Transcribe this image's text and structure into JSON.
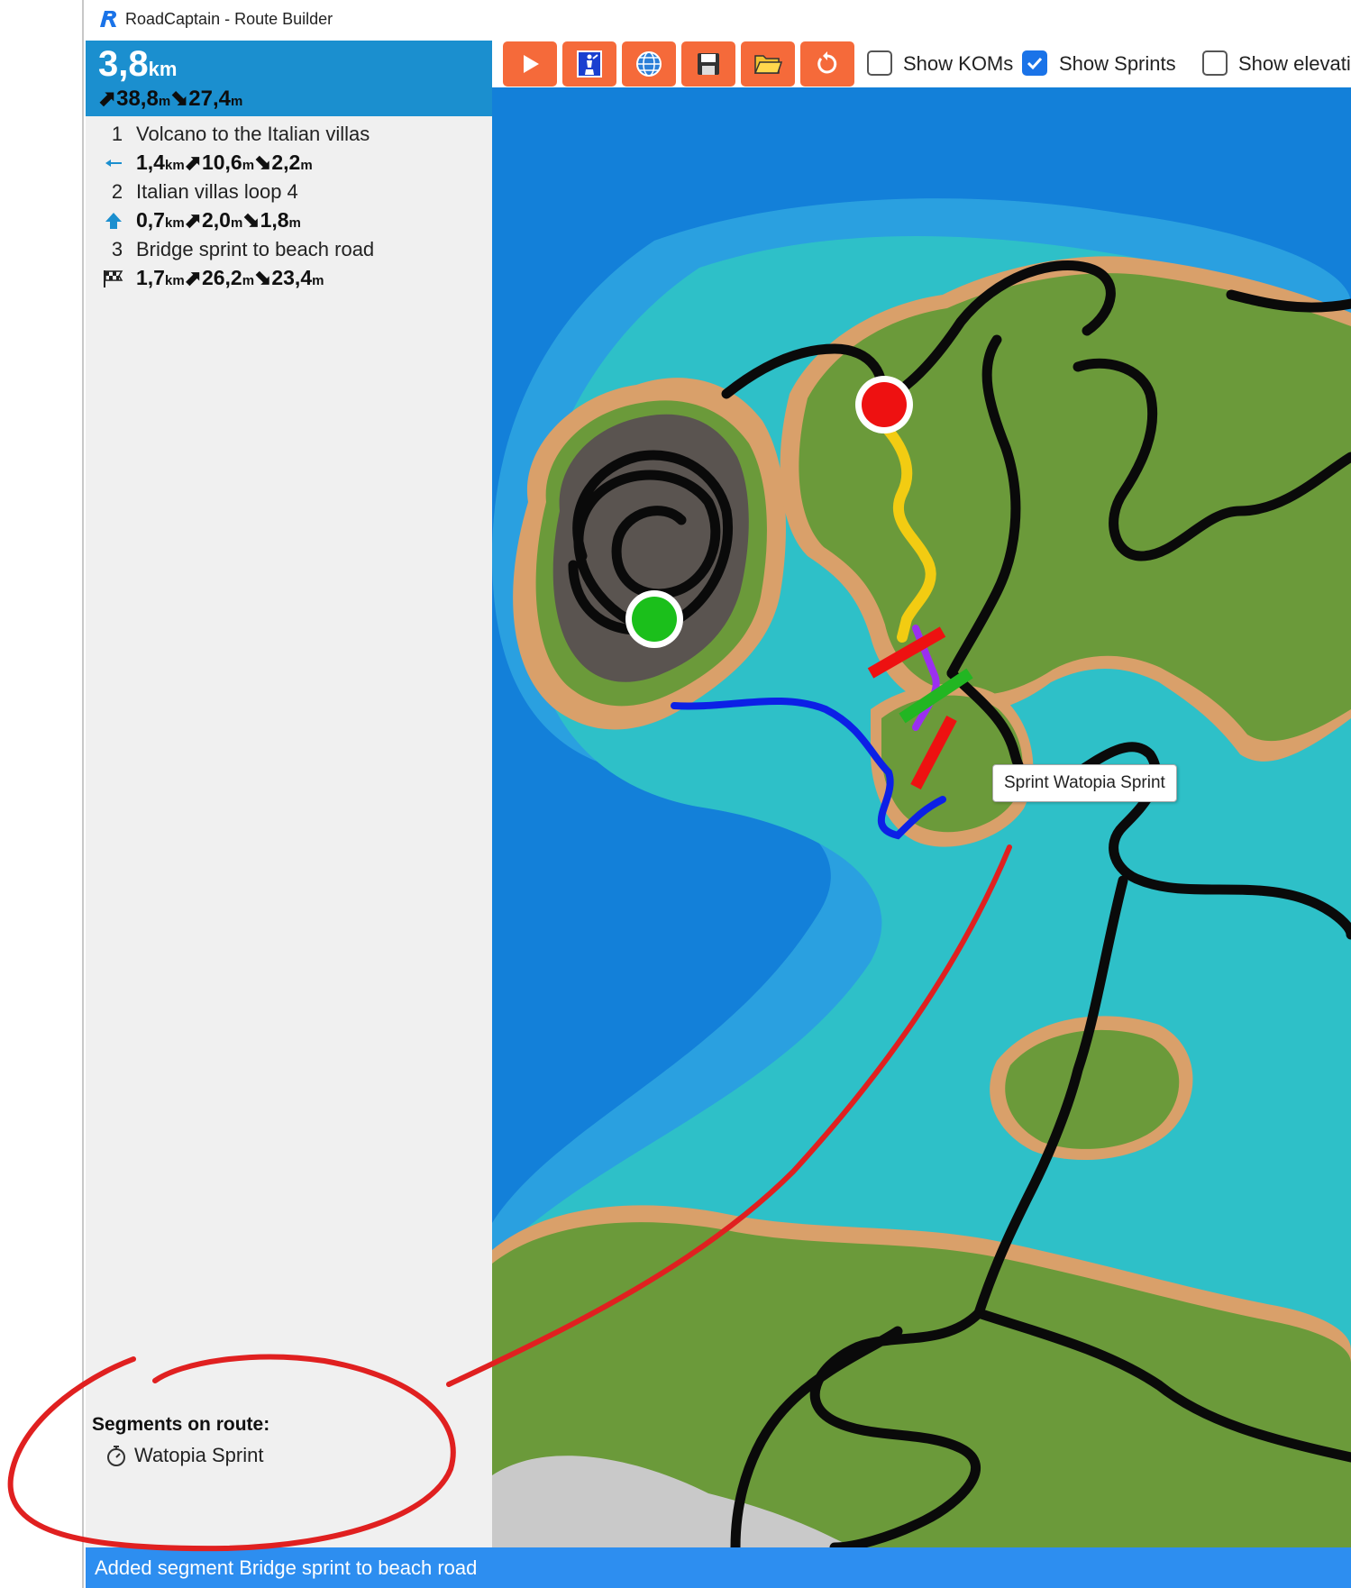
{
  "window": {
    "title": "RoadCaptain - Route Builder"
  },
  "summary": {
    "distance": "3,8",
    "distance_unit": "km",
    "ascent": "38,8",
    "descent": "27,4",
    "elev_unit": "m"
  },
  "route_segments": [
    {
      "number": "1",
      "name": "Volcano to the Italian villas",
      "direction_icon": "arrow-left-icon",
      "distance": "1,4",
      "ascent": "10,6",
      "descent": "2,2"
    },
    {
      "number": "2",
      "name": "Italian villas loop 4",
      "direction_icon": "arrow-up-icon",
      "distance": "0,7",
      "ascent": "2,0",
      "descent": "1,8"
    },
    {
      "number": "3",
      "name": "Bridge sprint to beach road",
      "direction_icon": "finish-flag-icon",
      "distance": "1,7",
      "ascent": "26,2",
      "descent": "23,4"
    }
  ],
  "units": {
    "km": "km",
    "m": "m"
  },
  "segments_on_route": {
    "title": "Segments on route:",
    "items": [
      {
        "icon": "stopwatch-icon",
        "name": "Watopia Sprint"
      }
    ]
  },
  "toolbar": {
    "buttons": [
      "play-icon",
      "clear-route-icon",
      "world-icon",
      "save-icon",
      "open-folder-icon",
      "reset-icon"
    ],
    "accent": "#f56a3a",
    "checkboxes": [
      {
        "label": "Show KOMs",
        "checked": false
      },
      {
        "label": "Show Sprints",
        "checked": true
      },
      {
        "label": "Show elevatio",
        "checked": false
      }
    ]
  },
  "map": {
    "tooltip": "Sprint Watopia Sprint"
  },
  "status": {
    "message": "Added segment Bridge sprint to beach road"
  },
  "colors": {
    "summary_bg": "#1b8fcf",
    "status_bg": "#2d8ef0",
    "sidebar_bg": "#f0f0f0",
    "route_start": "#1bbf1b",
    "route_end": "#ee1111",
    "annotation": "#e02020"
  }
}
